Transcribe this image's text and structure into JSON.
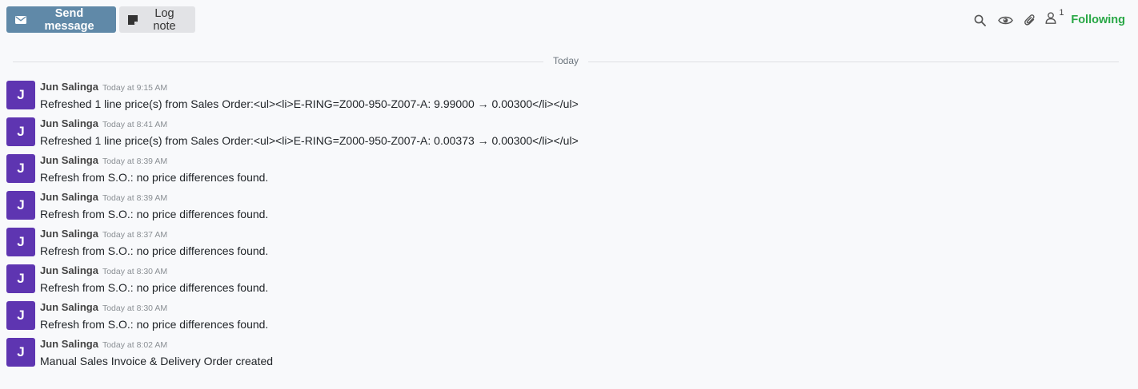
{
  "toolbar": {
    "send_label": "Send message",
    "log_label": "Log note",
    "followers_count": "1",
    "following_label": "Following"
  },
  "divider": {
    "label": "Today"
  },
  "messages": [
    {
      "initial": "J",
      "author": "Jun Salinga",
      "time": "Today at 9:15 AM",
      "body": "Refreshed 1 line price(s) from Sales Order:<ul><li>E-RING=Z000-950-Z007-A: 9.99000 → 0.00300</li></ul>"
    },
    {
      "initial": "J",
      "author": "Jun Salinga",
      "time": "Today at 8:41 AM",
      "body": "Refreshed 1 line price(s) from Sales Order:<ul><li>E-RING=Z000-950-Z007-A: 0.00373 → 0.00300</li></ul>"
    },
    {
      "initial": "J",
      "author": "Jun Salinga",
      "time": "Today at 8:39 AM",
      "body": "Refresh from S.O.: no price differences found."
    },
    {
      "initial": "J",
      "author": "Jun Salinga",
      "time": "Today at 8:39 AM",
      "body": "Refresh from S.O.: no price differences found."
    },
    {
      "initial": "J",
      "author": "Jun Salinga",
      "time": "Today at 8:37 AM",
      "body": "Refresh from S.O.: no price differences found."
    },
    {
      "initial": "J",
      "author": "Jun Salinga",
      "time": "Today at 8:30 AM",
      "body": "Refresh from S.O.: no price differences found."
    },
    {
      "initial": "J",
      "author": "Jun Salinga",
      "time": "Today at 8:30 AM",
      "body": "Refresh from S.O.: no price differences found."
    },
    {
      "initial": "J",
      "author": "Jun Salinga",
      "time": "Today at 8:02 AM",
      "body": "Manual Sales Invoice & Delivery Order created"
    }
  ]
}
